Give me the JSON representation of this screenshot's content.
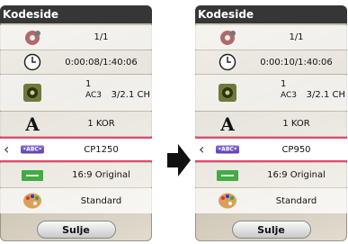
{
  "left_panel": {
    "title": "Kodeside",
    "rows": [
      {
        "icon": "disc-icon",
        "value": "1/1"
      },
      {
        "icon": "clock-icon",
        "value": "0:00:08/1:40:06"
      },
      {
        "icon": "speaker-icon",
        "value": "1",
        "codec": "AC3",
        "channels": "3/2.1 CH"
      },
      {
        "icon": "subtitle-a-icon",
        "value": "1 KOR"
      },
      {
        "icon": "abc-code-icon",
        "value": "CP1250"
      },
      {
        "icon": "aspect-ratio-icon",
        "value": "16:9 Original"
      },
      {
        "icon": "palette-icon",
        "value": "Standard"
      }
    ],
    "close_label": "Sulje"
  },
  "right_panel": {
    "title": "Kodeside",
    "rows": [
      {
        "icon": "disc-icon",
        "value": "1/1"
      },
      {
        "icon": "clock-icon",
        "value": "0:00:10/1:40:06"
      },
      {
        "icon": "speaker-icon",
        "value": "1",
        "codec": "AC3",
        "channels": "3/2.1 CH"
      },
      {
        "icon": "subtitle-a-icon",
        "value": "1 KOR"
      },
      {
        "icon": "abc-code-icon",
        "value": "CP950"
      },
      {
        "icon": "aspect-ratio-icon",
        "value": "16:9 Original"
      },
      {
        "icon": "palette-icon",
        "value": "Standard"
      }
    ],
    "close_label": "Sulje"
  },
  "icons": {
    "abc_text": "•ABC•"
  },
  "colors": {
    "highlight": "#e8466f",
    "title_bar": "#363636",
    "aspect_icon": "#44aa44"
  }
}
